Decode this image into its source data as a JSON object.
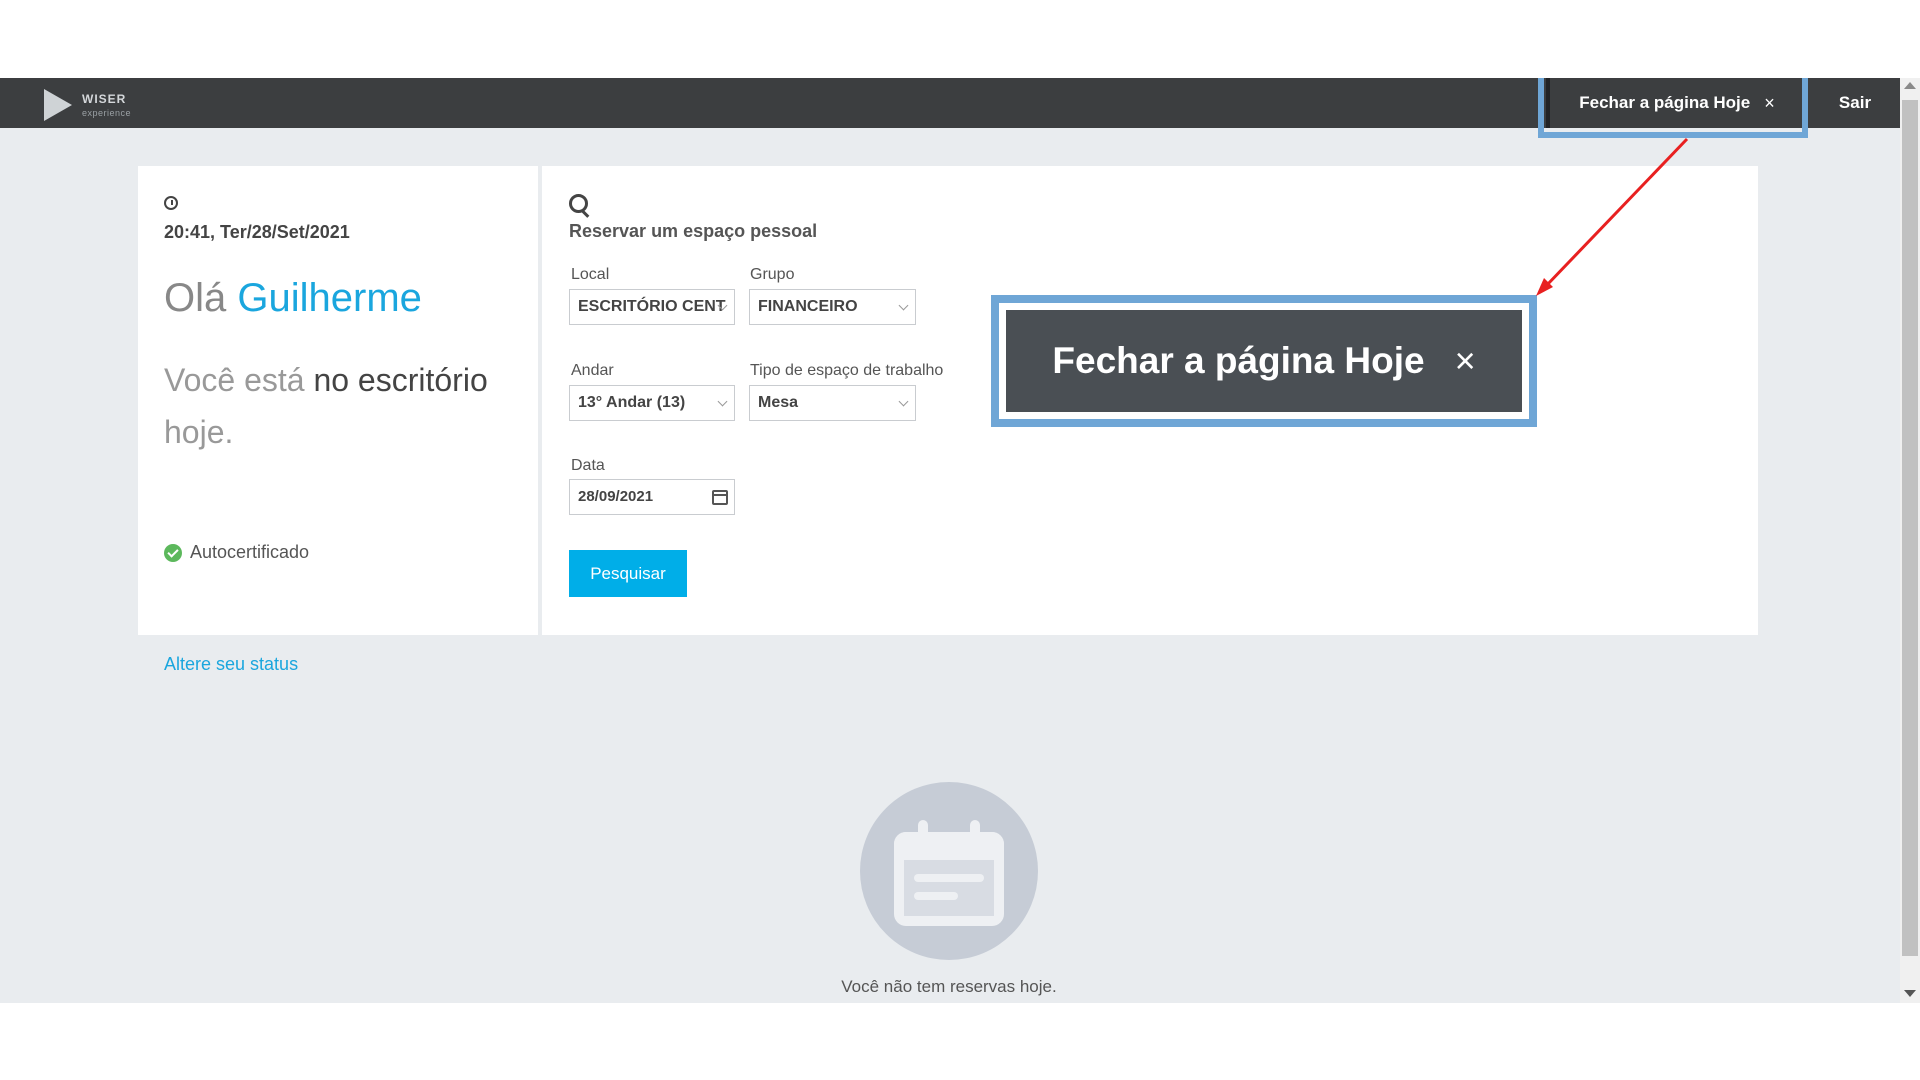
{
  "topbar": {
    "logo_text": "WISER",
    "logo_sub": "experience",
    "close_today_label": "Fechar a página Hoje",
    "close_symbol": "×",
    "logout_label": "Sair"
  },
  "status_card": {
    "datetime": "20:41, Ter/28/Set/2021",
    "greeting": "Olá",
    "user_name": "Guilherme",
    "status_prefix": "Você está",
    "status_strong": "no escritório",
    "status_suffix": "hoje.",
    "certification": "Autocertificado",
    "change_status_link": "Altere seu status"
  },
  "reservation": {
    "title": "Reservar um espaço pessoal",
    "local_label": "Local",
    "local_value": "ESCRITÓRIO CENT",
    "group_label": "Grupo",
    "group_value": "FINANCEIRO",
    "floor_label": "Andar",
    "floor_value": "13° Andar (13)",
    "workspace_label": "Tipo de espaço de trabalho",
    "workspace_value": "Mesa",
    "date_label": "Data",
    "date_value": "28/09/2021",
    "search_button": "Pesquisar"
  },
  "callout": {
    "label": "Fechar a página Hoje",
    "close_symbol": "×"
  },
  "empty_state": {
    "message": "Você não tem reservas hoje."
  },
  "colors": {
    "accent": "#1aa6de",
    "button": "#00aee8",
    "topbar": "#3c3e40",
    "highlight": "#6fa6d6",
    "arrow": "#e82020"
  }
}
